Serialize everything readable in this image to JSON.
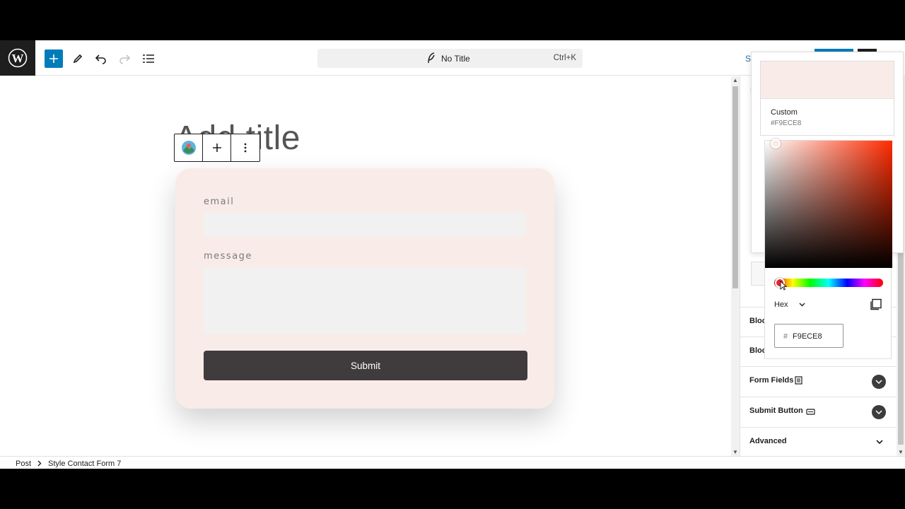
{
  "toolbar": {
    "document_title": "No Title",
    "shortcut": "Ctrl+K",
    "save_label": "Sa"
  },
  "canvas": {
    "post_title_placeholder": "Add title"
  },
  "form": {
    "email_label": "email",
    "message_label": "message",
    "submit_label": "Submit",
    "background": "#F9ECE8",
    "button_color": "#403B3D"
  },
  "color_picker": {
    "swatch_name": "Custom",
    "swatch_hex": "#F9ECE8",
    "format": "Hex",
    "hex_prefix": "#",
    "hex_value": "F9ECE8"
  },
  "sidebar": {
    "rows": [
      {
        "label": "Bloc"
      },
      {
        "label": "Bloc"
      },
      {
        "label": "Form Fields",
        "icon": "form-icon"
      },
      {
        "label": "Submit Button",
        "icon": "button-icon"
      },
      {
        "label": "Advanced",
        "icon": "chevron-down-icon"
      }
    ]
  },
  "breadcrumb": {
    "root": "Post",
    "current": "Style Contact Form 7"
  },
  "colors": {
    "accent": "#007CBA",
    "dark": "#1E1E1E"
  }
}
